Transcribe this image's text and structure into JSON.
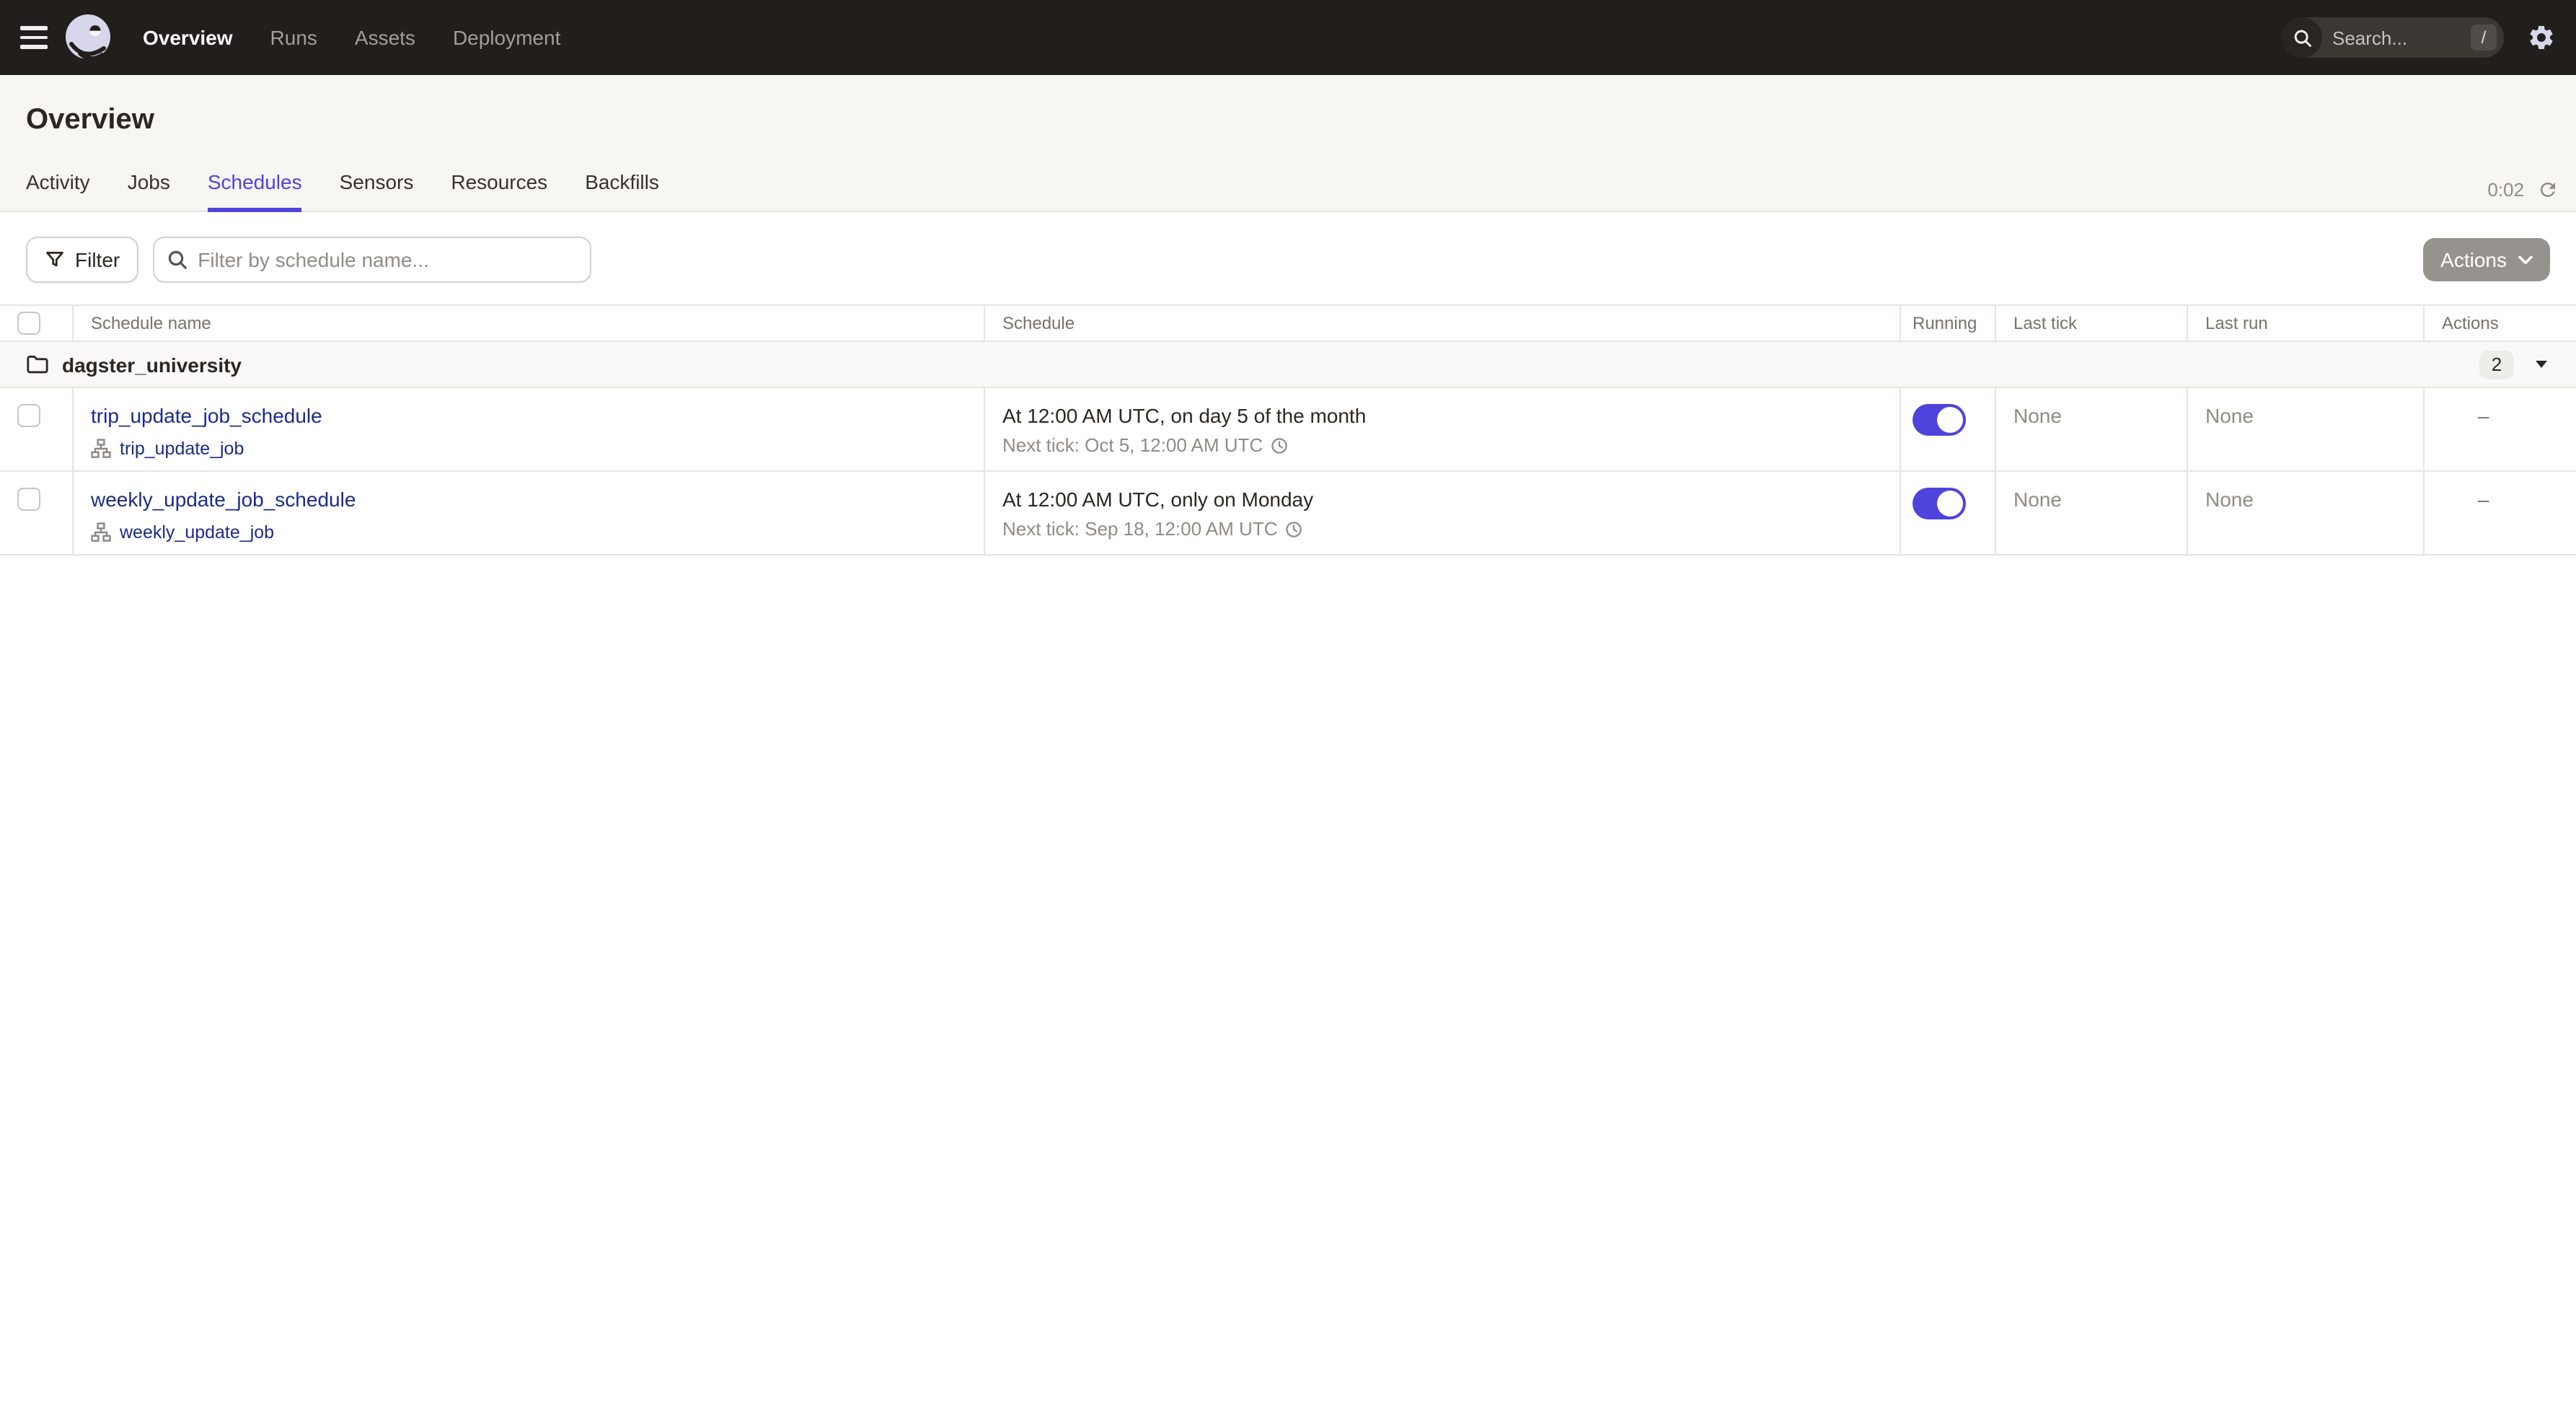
{
  "colors": {
    "accent": "#4F43DD",
    "link": "#1C2B8C",
    "nav-bg": "#221E1B",
    "page-bg": "#F7F6F3",
    "border": "#E7E4E1",
    "text": "#2B2723",
    "muted": "#8F8B86",
    "toggle-on": "#4F43DD"
  },
  "nav": {
    "items": [
      {
        "label": "Overview"
      },
      {
        "label": "Runs"
      },
      {
        "label": "Assets"
      },
      {
        "label": "Deployment"
      }
    ],
    "search_placeholder": "Search...",
    "search_shortcut": "/"
  },
  "page": {
    "title": "Overview"
  },
  "tabs": {
    "items": [
      {
        "label": "Activity"
      },
      {
        "label": "Jobs"
      },
      {
        "label": "Schedules"
      },
      {
        "label": "Sensors"
      },
      {
        "label": "Resources"
      },
      {
        "label": "Backfills"
      }
    ],
    "refresh_timer": "0:02"
  },
  "toolbar": {
    "filter_label": "Filter",
    "filter_placeholder": "Filter by schedule name...",
    "actions_label": "Actions"
  },
  "table": {
    "columns": [
      "Schedule name",
      "Schedule",
      "Running",
      "Last tick",
      "Last run",
      "Actions"
    ],
    "group": {
      "name": "dagster_university",
      "count": "2"
    },
    "rows": [
      {
        "name": "trip_update_job_schedule",
        "job": "trip_update_job",
        "schedule": "At 12:00 AM UTC, on day 5 of the month",
        "next_tick": "Next tick: Oct 5, 12:00 AM UTC",
        "last_tick": "None",
        "last_run": "None",
        "actions": "–"
      },
      {
        "name": "weekly_update_job_schedule",
        "job": "weekly_update_job",
        "schedule": "At 12:00 AM UTC, only on Monday",
        "next_tick": "Next tick: Sep 18, 12:00 AM UTC",
        "last_tick": "None",
        "last_run": "None",
        "actions": "–"
      }
    ]
  }
}
